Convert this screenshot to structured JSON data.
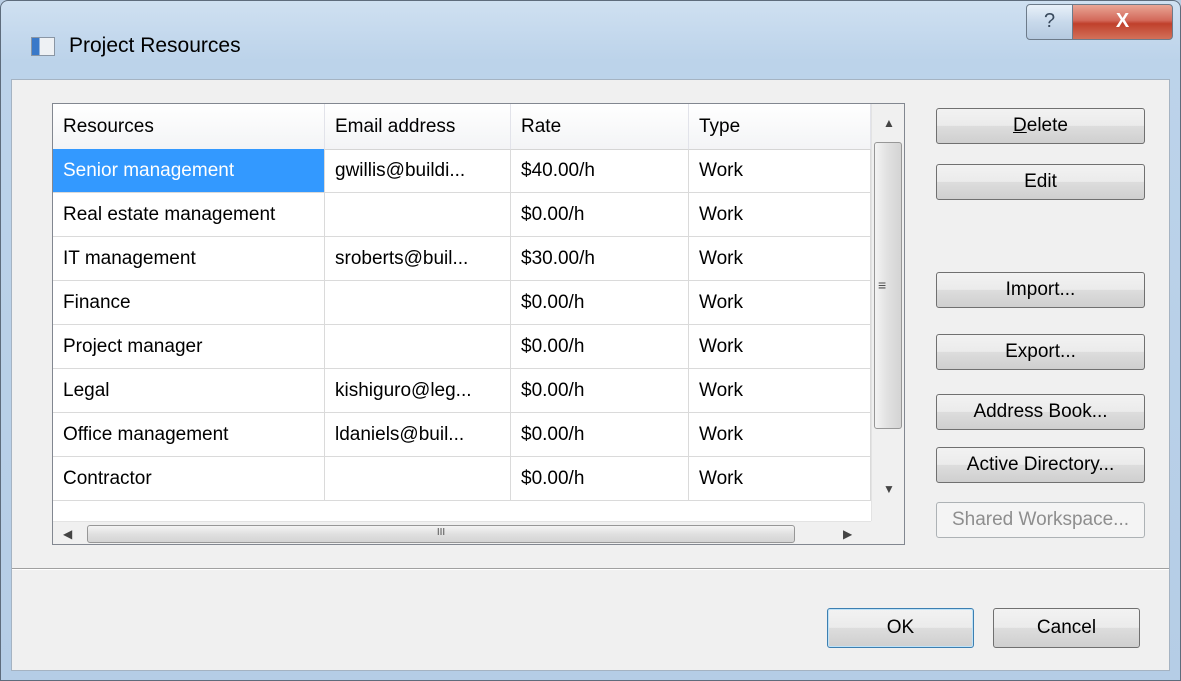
{
  "window": {
    "title": "Project Resources"
  },
  "caption": {
    "help_glyph": "?",
    "close_glyph": "X"
  },
  "grid": {
    "columns": [
      "Resources",
      "Email address",
      "Rate",
      "Type"
    ],
    "rows": [
      {
        "resource": "Senior management",
        "email": "gwillis@buildi...",
        "rate": "$40.00/h",
        "type": "Work",
        "selected": true
      },
      {
        "resource": "Real estate management",
        "email": "",
        "rate": "$0.00/h",
        "type": "Work"
      },
      {
        "resource": "IT management",
        "email": "sroberts@buil...",
        "rate": "$30.00/h",
        "type": "Work"
      },
      {
        "resource": "Finance",
        "email": "",
        "rate": "$0.00/h",
        "type": "Work"
      },
      {
        "resource": "Project manager",
        "email": "",
        "rate": "$0.00/h",
        "type": "Work"
      },
      {
        "resource": "Legal",
        "email": "kishiguro@leg...",
        "rate": "$0.00/h",
        "type": "Work"
      },
      {
        "resource": "Office management",
        "email": "ldaniels@buil...",
        "rate": "$0.00/h",
        "type": "Work"
      },
      {
        "resource": "Contractor",
        "email": "",
        "rate": "$0.00/h",
        "type": "Work"
      }
    ],
    "vscroll": {
      "up": "▲",
      "down": "▼",
      "grip": "≡"
    },
    "hscroll": {
      "left": "◀",
      "right": "▶",
      "grip": "III"
    }
  },
  "buttons": {
    "delete": {
      "accel": "D",
      "rest": "elete"
    },
    "edit": "Edit",
    "import": "Import...",
    "export": "Export...",
    "address_book": "Address Book...",
    "active_directory": "Active Directory...",
    "shared_workspace": "Shared Workspace...",
    "ok": "OK",
    "cancel": "Cancel"
  },
  "colors": {
    "selection": "#3399ff",
    "frame": "#b9cde3",
    "close": "#c0402c"
  }
}
